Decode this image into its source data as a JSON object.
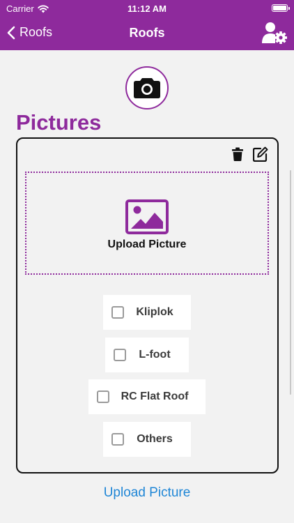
{
  "status_bar": {
    "carrier": "Carrier",
    "time": "11:12 AM"
  },
  "nav": {
    "back_label": "Roofs",
    "title": "Roofs"
  },
  "section": {
    "title": "Pictures"
  },
  "card": {
    "drop_zone_label": "Upload Picture",
    "options": [
      {
        "label": "Kliplok",
        "checked": false
      },
      {
        "label": "L-foot",
        "checked": false
      },
      {
        "label": "RC Flat Roof",
        "checked": false
      },
      {
        "label": "Others",
        "checked": false
      }
    ]
  },
  "footer": {
    "upload_link": "Upload Picture"
  },
  "colors": {
    "brand": "#8e2a9c",
    "link": "#1f86d6",
    "background": "#f2f2f2"
  },
  "icons": {
    "status": [
      "wifi-icon",
      "battery-icon"
    ],
    "nav": [
      "chevron-left-icon",
      "user-settings-icon"
    ],
    "main": [
      "camera-icon",
      "trash-icon",
      "edit-icon",
      "image-icon"
    ]
  }
}
